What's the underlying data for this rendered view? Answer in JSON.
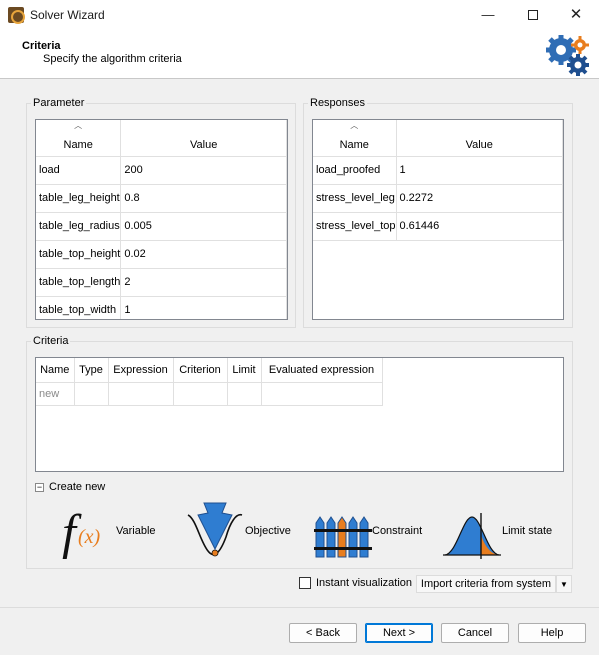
{
  "window": {
    "title": "Solver Wizard",
    "minimize_glyph": "—",
    "close_glyph": "✕"
  },
  "header": {
    "title": "Criteria",
    "subtitle": "Specify the algorithm criteria",
    "icon": "gears-icon"
  },
  "parameter": {
    "group_title": "Parameter",
    "columns": [
      "Name",
      "Value"
    ],
    "rows": [
      {
        "name": "load",
        "value": "200"
      },
      {
        "name": "table_leg_height",
        "value": "0.8"
      },
      {
        "name": "table_leg_radius",
        "value": "0.005"
      },
      {
        "name": "table_top_height",
        "value": "0.02"
      },
      {
        "name": "table_top_length",
        "value": "2"
      },
      {
        "name": "table_top_width",
        "value": "1"
      }
    ]
  },
  "responses": {
    "group_title": "Responses",
    "columns": [
      "Name",
      "Value"
    ],
    "rows": [
      {
        "name": "load_proofed",
        "value": "1"
      },
      {
        "name": "stress_level_leg",
        "value": "0.2272"
      },
      {
        "name": "stress_level_top",
        "value": "0.61446"
      }
    ]
  },
  "criteria": {
    "group_title": "Criteria",
    "columns": [
      "Name",
      "Type",
      "Expression",
      "Criterion",
      "Limit",
      "Evaluated expression"
    ],
    "new_row_placeholder": "new",
    "create_new_label": "Create new",
    "expander_glyph": "−",
    "tools": [
      {
        "label": "Variable",
        "icon": "variable-function-icon"
      },
      {
        "label": "Objective",
        "icon": "objective-arrow-icon"
      },
      {
        "label": "Constraint",
        "icon": "constraint-fence-icon"
      },
      {
        "label": "Limit state",
        "icon": "limit-state-distribution-icon"
      }
    ],
    "variable_glyph_f": "f",
    "variable_glyph_x": "(x)"
  },
  "options": {
    "instant_visualization_label": "Instant visualization",
    "instant_visualization_checked": false,
    "import_button_label": "Import criteria from system",
    "dropdown_glyph": "▼"
  },
  "buttons": {
    "back": "< Back",
    "next": "Next >",
    "cancel": "Cancel",
    "help": "Help"
  },
  "colors": {
    "accent_blue": "#0078d7",
    "orange": "#e87d1e",
    "icon_blue": "#2f6db5"
  }
}
